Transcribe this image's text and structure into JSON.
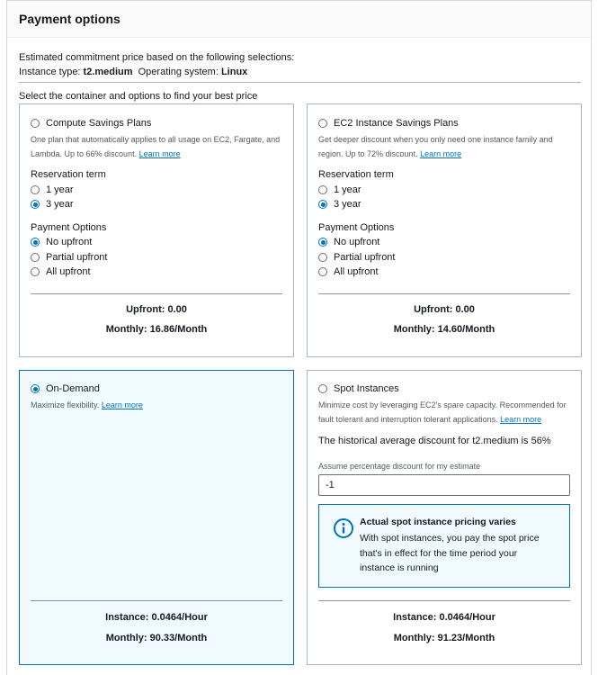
{
  "panel": {
    "title": "Payment options"
  },
  "summary": {
    "line1": "Estimated commitment price based on the following selections:",
    "instance_label": "Instance type: ",
    "instance_value": "t2.medium",
    "os_label": "Operating system: ",
    "os_value": "Linux",
    "select_text": "Select the container and options to find your best price"
  },
  "compute_plan": {
    "title": "Compute Savings Plans",
    "selected": false,
    "description": "One plan that automatically applies to all usage on EC2, Fargate, and Lambda. Up to 66% discount.",
    "learn_more": "Learn more",
    "term_label": "Reservation term",
    "term_options": [
      "1 year",
      "3 year"
    ],
    "term_selected": "3 year",
    "payment_label": "Payment Options",
    "payment_options": [
      "No upfront",
      "Partial upfront",
      "All upfront"
    ],
    "payment_selected": "No upfront",
    "upfront": "Upfront: 0.00",
    "monthly": "Monthly: 16.86/Month"
  },
  "ec2_plan": {
    "title": "EC2 Instance Savings Plans",
    "selected": false,
    "description": "Get deeper discount when you only need one instance family and region. Up to 72% discount.",
    "learn_more": "Learn more",
    "term_label": "Reservation term",
    "term_options": [
      "1 year",
      "3 year"
    ],
    "term_selected": "3 year",
    "payment_label": "Payment Options",
    "payment_options": [
      "No upfront",
      "Partial upfront",
      "All upfront"
    ],
    "payment_selected": "No upfront",
    "upfront": "Upfront: 0.00",
    "monthly": "Monthly: 14.60/Month"
  },
  "on_demand": {
    "title": "On-Demand",
    "selected": true,
    "description": "Maximize flexibility.",
    "learn_more": "Learn more",
    "instance_price": "Instance: 0.0464/Hour",
    "monthly": "Monthly: 90.33/Month"
  },
  "spot": {
    "title": "Spot Instances",
    "selected": false,
    "description": "Minimize cost by leveraging EC2's spare capacity. Recommended for fault tolerant and interruption tolerant applications.",
    "learn_more": "Learn more",
    "historical": "The historical average discount for t2.medium is 56%",
    "input_label": "Assume percentage discount for my estimate",
    "input_value": "-1",
    "info_title": "Actual spot instance pricing varies",
    "info_body": "With spot instances, you pay the spot price that's in effect for the time period your instance is running",
    "instance_price": "Instance: 0.0464/Hour",
    "monthly": "Monthly: 91.23/Month"
  },
  "colors": {
    "accent": "#0073bb",
    "selected_bg": "#f1faff",
    "border": "#aab7b8"
  },
  "icons": {
    "info": "info-circle-icon"
  }
}
